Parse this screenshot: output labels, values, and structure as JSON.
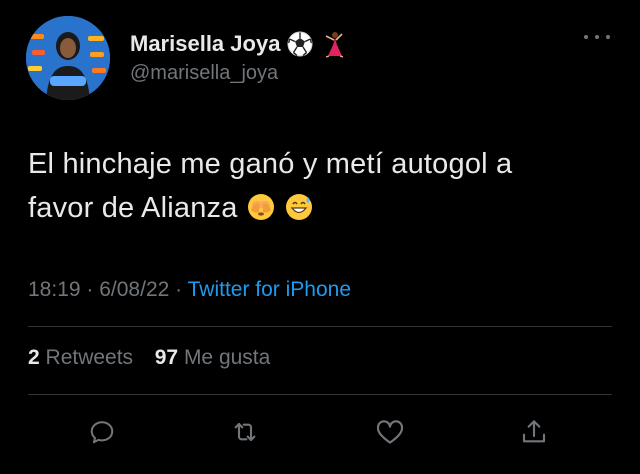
{
  "user": {
    "display_name": "Marisella Joya",
    "handle": "@marisella_joya",
    "badges": [
      "soccer-ball-emoji",
      "dancer-emoji"
    ]
  },
  "tweet": {
    "text_line1": "El hinchaje me ganó y metí autogol a",
    "text_line2": "favor de Alianza",
    "emojis": [
      "see-no-evil-monkey-emoji",
      "grinning-sweat-emoji"
    ],
    "time": "18:19",
    "sep1": " · ",
    "date": "6/08/22",
    "sep2": " · ",
    "source": "Twitter for iPhone"
  },
  "stats": {
    "retweets_count": "2",
    "retweets_label": " Retweets",
    "likes_count": "97",
    "likes_label": " Me gusta"
  },
  "actions": [
    "reply-icon",
    "retweet-icon",
    "like-icon",
    "share-icon"
  ],
  "colors": {
    "background": "#000000",
    "text": "#e7e9ea",
    "secondary": "#71767b",
    "link": "#1d9bf0",
    "divider": "#2f3336"
  }
}
